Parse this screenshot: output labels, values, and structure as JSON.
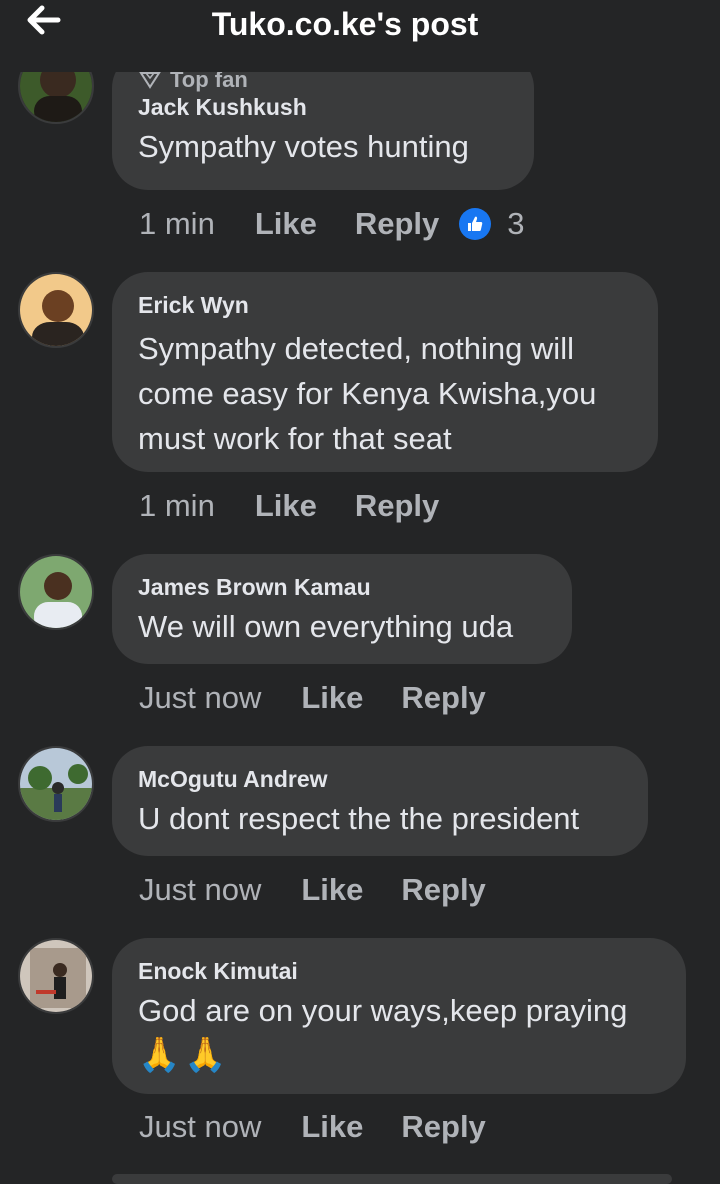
{
  "header": {
    "title": "Tuko.co.ke's post"
  },
  "comments": [
    {
      "badge": "Top fan",
      "author": "Jack Kushkush",
      "text": "Sympathy  votes hunting",
      "time": "1 min",
      "like": "Like",
      "reply": "Reply",
      "reaction_count": "3"
    },
    {
      "author": "Erick Wyn",
      "text": "Sympathy detected, nothing will come easy for Kenya Kwisha,you must work for that seat",
      "time": "1 min",
      "like": "Like",
      "reply": "Reply"
    },
    {
      "author": "James Brown Kamau",
      "text": "We will own everything uda",
      "time": "Just now",
      "like": "Like",
      "reply": "Reply"
    },
    {
      "author": "McOgutu Andrew",
      "text": "U dont respect the the president",
      "time": "Just now",
      "like": "Like",
      "reply": "Reply"
    },
    {
      "author": "Enock Kimutai",
      "text": "God are on your ways,keep praying",
      "emoji": "🙏🙏",
      "time": "Just now",
      "like": "Like",
      "reply": "Reply"
    }
  ],
  "colors": {
    "background": "#242526",
    "bubble": "#3a3b3c",
    "text": "#e4e6eb",
    "muted": "#b0b3b8",
    "like_reaction": "#1877f2"
  }
}
